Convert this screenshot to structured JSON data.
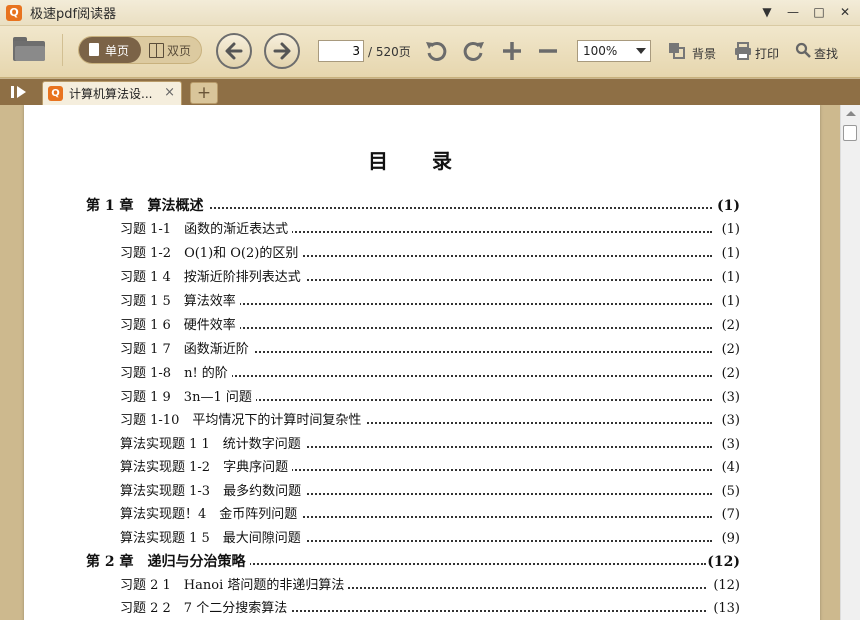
{
  "app": {
    "title": "极速pdf阅读器",
    "logo_glyph": "Q",
    "accent": "#e8731f"
  },
  "window_controls": {
    "menu_icon": "▼",
    "minimize_icon": "—",
    "maximize_icon": "□",
    "close_icon": "✕"
  },
  "toolbar": {
    "single_page": "单页",
    "double_page": "双页",
    "page_current": "3",
    "page_total": "/ 520页",
    "zoom": "100%",
    "background": "背景",
    "print": "打印",
    "search": "查找"
  },
  "tabs": {
    "active_title": "计算机算法设...",
    "close_glyph": "×",
    "new_tab_glyph": "+"
  },
  "document": {
    "title": "目录",
    "entries": [
      {
        "label": "第 1 章　算法概述",
        "page": "(1)",
        "chapter": true
      },
      {
        "label": "习题 1-1　函数的渐近表达式",
        "page": "(1)"
      },
      {
        "label": "习题 1-2　O(1)和 O(2)的区别",
        "page": "(1)"
      },
      {
        "label": "习题 1 4　按渐近阶排列表达式",
        "page": "(1)"
      },
      {
        "label": "习题 1 5　算法效率",
        "page": "(1)"
      },
      {
        "label": "习题 1 6　硬件效率",
        "page": "(2)"
      },
      {
        "label": "习题 1 7　函数渐近阶",
        "page": "(2)"
      },
      {
        "label": "习题 1-8　n! 的阶",
        "page": "(2)"
      },
      {
        "label": "习题 1 9　3n—1 问题",
        "page": "(3)"
      },
      {
        "label": "习题 1-10　平均情况下的计算时间复杂性",
        "page": "(3)"
      },
      {
        "label": "算法实现题 1 1　统计数字问题",
        "page": "(3)"
      },
      {
        "label": "算法实现题 1-2　字典序问题",
        "page": "(4)"
      },
      {
        "label": "算法实现题 1-3　最多约数问题",
        "page": "(5)"
      },
      {
        "label": "算法实现题！4　金币阵列问题",
        "page": "(7)"
      },
      {
        "label": "算法实现题 1 5　最大间隙问题",
        "page": "(9)"
      },
      {
        "label": "第 2 章　递归与分治策略",
        "page": "(12)",
        "chapter": true
      },
      {
        "label": "习题 2 1　Hanoi 塔问题的非递归算法",
        "page": "(12)"
      },
      {
        "label": "习题 2 2　7 个二分搜索算法",
        "page": "(13)"
      }
    ]
  }
}
